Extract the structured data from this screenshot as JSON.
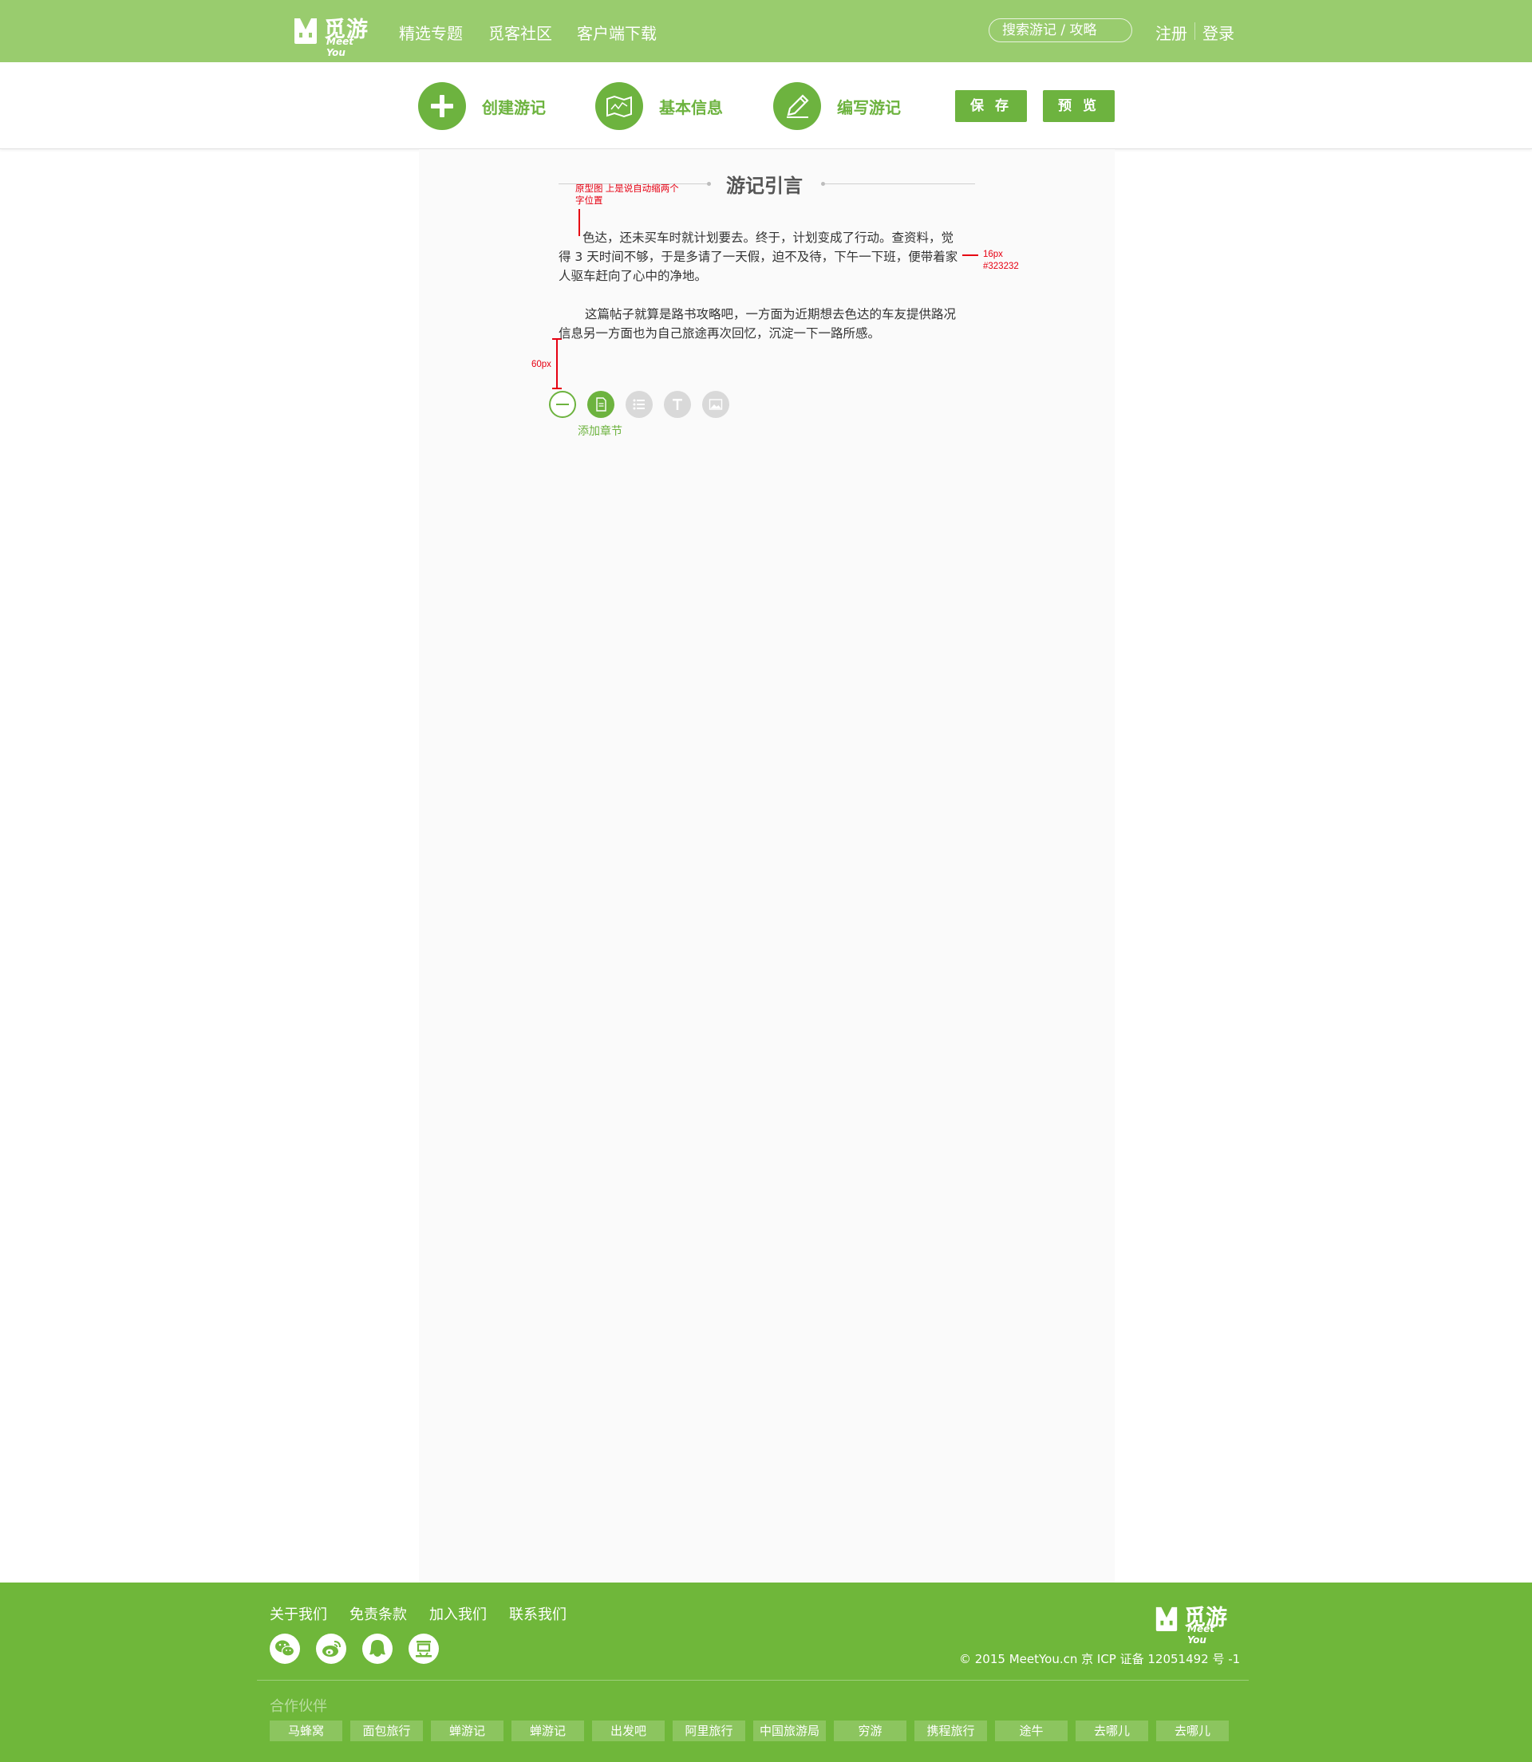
{
  "header": {
    "logo_cn": "觅游",
    "logo_en": "Meet You",
    "nav": [
      "精选专题",
      "觅客社区",
      "客户端下载"
    ],
    "search_placeholder": "搜索游记 / 攻略",
    "register": "注册",
    "login": "登录"
  },
  "steps": [
    {
      "label": "创建游记",
      "icon": "plus-icon"
    },
    {
      "label": "基本信息",
      "icon": "map-icon"
    },
    {
      "label": "编写游记",
      "icon": "pencil-icon"
    }
  ],
  "actions": {
    "save": "保 存",
    "preview": "预 览"
  },
  "article": {
    "section_title": "游记引言",
    "paragraph1": [
      "色达，还未买车时就计划要去。终于，计划变成了行动。查资料，觉",
      "得 3 天时间不够，于是多请了一天假，迫不及待，下午一下班，便带着家",
      "人驱车赶向了心中的净地。"
    ],
    "paragraph2": [
      "这篇帖子就算是路书攻略吧，一方面为近期想去色达的车友提供路况",
      "信息另一方面也为自己旅途再次回忆，沉淀一下一路所感。"
    ],
    "add_chapter": "添加章节"
  },
  "annotations": {
    "indent_note_line1": "原型图 上是说自动缩两个",
    "indent_note_line2": "字位置",
    "font_size_note": "16px",
    "color_note": "#323232",
    "spacing_note": "60px"
  },
  "toolbar": [
    {
      "icon": "minus-icon"
    },
    {
      "icon": "document-icon"
    },
    {
      "icon": "list-icon"
    },
    {
      "icon": "text-icon"
    },
    {
      "icon": "image-icon"
    }
  ],
  "footer": {
    "links": [
      "关于我们",
      "免责条款",
      "加入我们",
      "联系我们"
    ],
    "social": [
      "wechat-icon",
      "weibo-icon",
      "qq-icon",
      "douban-icon"
    ],
    "logo_cn": "觅游",
    "logo_en": "Meet You",
    "copyright": "© 2015 MeetYou.cn   京 ICP 证备 12051492 号 -1",
    "partners_title": "合作伙伴",
    "partners": [
      "马蜂窝",
      "面包旅行",
      "蝉游记",
      "蝉游记",
      "出发吧",
      "阿里旅行",
      "中国旅游局",
      "穷游",
      "携程旅行",
      "途牛",
      "去哪儿",
      "去哪儿"
    ]
  },
  "colors": {
    "topbar": "#99cc6e",
    "accent": "#6db33f",
    "footer": "#6fb73a",
    "annotation": "#e60012",
    "body_text": "#323232"
  }
}
